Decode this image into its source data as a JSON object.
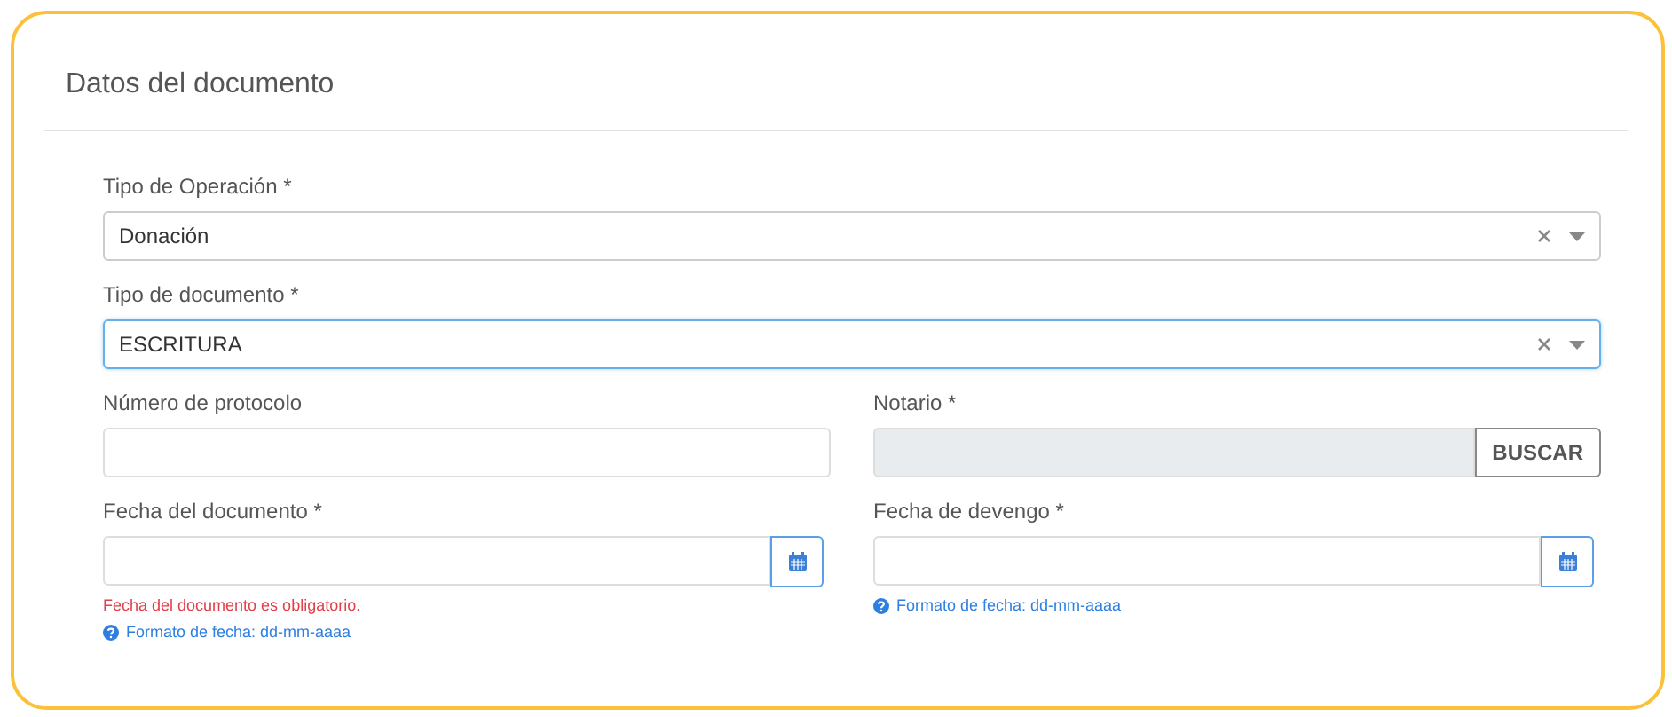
{
  "card": {
    "title": "Datos del documento"
  },
  "rows": [
    {
      "fields": [
        {
          "kind": "select",
          "label": "Tipo de Operación *",
          "value": "Donación",
          "focused": false
        }
      ]
    },
    {
      "fields": [
        {
          "kind": "select",
          "label": "Tipo de documento *",
          "value": "ESCRITURA",
          "focused": true
        }
      ]
    },
    {
      "fields": [
        {
          "kind": "text",
          "label": "Número de protocolo"
        },
        {
          "kind": "lookup",
          "label": "Notario *",
          "button": "BUSCAR",
          "disabled": true
        }
      ]
    },
    {
      "fields": [
        {
          "kind": "date",
          "label": "Fecha del documento *",
          "error": "Fecha del documento es obligatorio.",
          "help": "Formato de fecha: dd-mm-aaaa"
        },
        {
          "kind": "date",
          "label": "Fecha de devengo *",
          "help": "Formato de fecha: dd-mm-aaaa"
        }
      ]
    }
  ]
}
